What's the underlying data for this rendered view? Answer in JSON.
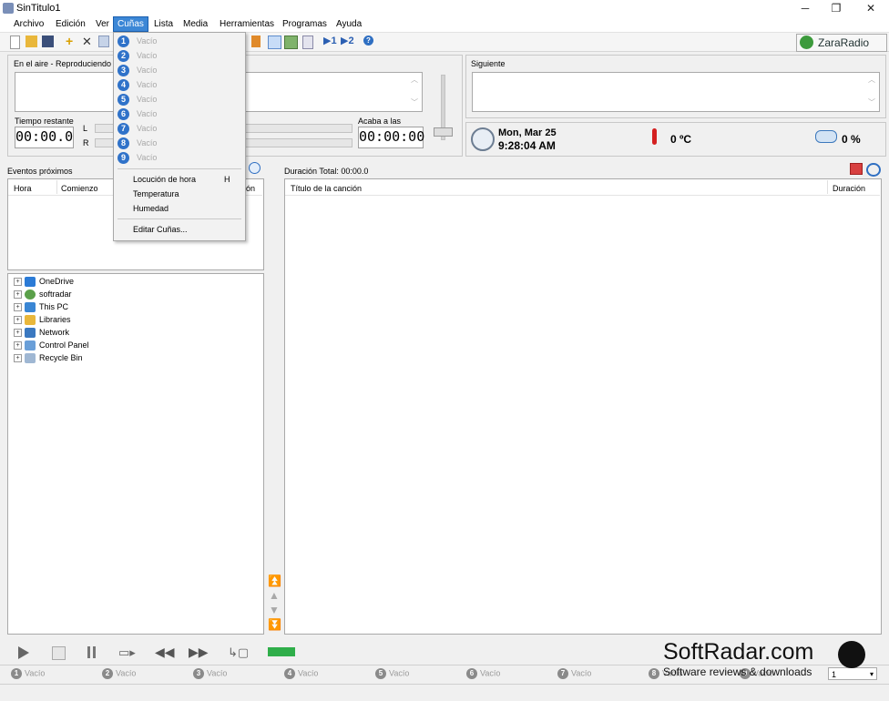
{
  "window": {
    "title": "SinTitulo1"
  },
  "menu": [
    "Archivo",
    "Edición",
    "Ver",
    "Cuñas",
    "Lista",
    "Media",
    "Herramientas",
    "Programas",
    "Ayuda"
  ],
  "brand": "ZaraRadio",
  "on_air": {
    "label": "En el aire - Reproduciendo a"
  },
  "next": {
    "label": "Siguiente"
  },
  "remaining": {
    "label": "Tiempo restante",
    "value": "00:00.0",
    "left": "L",
    "right": "R"
  },
  "ends_at": {
    "label": "Acaba a las",
    "value": "00:00:00"
  },
  "clock": {
    "date": "Mon, Mar 25",
    "time": "9:28:04 AM"
  },
  "temperature": "0 ºC",
  "humidity": "0 %",
  "upcoming": {
    "label": "Eventos próximos",
    "columns": [
      "Hora",
      "Comienzo",
      "ión"
    ]
  },
  "tree": [
    "OneDrive",
    "softradar",
    "This PC",
    "Libraries",
    "Network",
    "Control Panel",
    "Recycle Bin"
  ],
  "playlist": {
    "total": "Duración Total: 00:00.0",
    "col_title": "Título de la canción",
    "col_duration": "Duración"
  },
  "dropdown": {
    "slots": [
      {
        "n": "1",
        "label": "Vacío"
      },
      {
        "n": "2",
        "label": "Vacío"
      },
      {
        "n": "3",
        "label": "Vacío"
      },
      {
        "n": "4",
        "label": "Vacío"
      },
      {
        "n": "5",
        "label": "Vacío"
      },
      {
        "n": "6",
        "label": "Vacío"
      },
      {
        "n": "7",
        "label": "Vacío"
      },
      {
        "n": "8",
        "label": "Vacío"
      },
      {
        "n": "9",
        "label": "Vacío"
      }
    ],
    "hour": "Locución de hora",
    "hour_shortcut": "H",
    "temperature": "Temperatura",
    "humidity": "Humedad",
    "edit": "Editar Cuñas..."
  },
  "bottom_slots": [
    {
      "n": "1",
      "label": "Vacío"
    },
    {
      "n": "2",
      "label": "Vacío"
    },
    {
      "n": "3",
      "label": "Vacío"
    },
    {
      "n": "4",
      "label": "Vacío"
    },
    {
      "n": "5",
      "label": "Vacío"
    },
    {
      "n": "6",
      "label": "Vacío"
    },
    {
      "n": "7",
      "label": "Vacío"
    },
    {
      "n": "8",
      "label": "Vacío"
    },
    {
      "n": "9",
      "label": "Vacío"
    }
  ],
  "selector_value": "1",
  "watermark": {
    "title": "SoftRadar.com",
    "subtitle": "Software reviews & downloads"
  },
  "colors": {
    "menu_active": "#3c87d6",
    "slot_blue": "#2f72c9"
  }
}
